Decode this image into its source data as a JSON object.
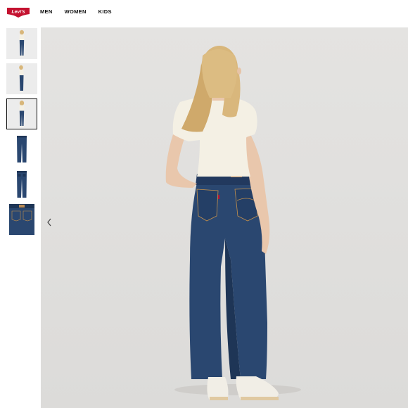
{
  "brand": {
    "logo_text": "Levi's",
    "color": "#c41230"
  },
  "nav": {
    "items": [
      "MEN",
      "WOMEN",
      "KIDS"
    ]
  },
  "gallery": {
    "thumbnails": [
      {
        "view": "front",
        "selected": false
      },
      {
        "view": "side",
        "selected": false
      },
      {
        "view": "back",
        "selected": true
      },
      {
        "view": "product-front",
        "selected": false
      },
      {
        "view": "product-back",
        "selected": false
      },
      {
        "view": "detail-waistband",
        "selected": false
      }
    ],
    "prev_icon": "chevron-left-icon"
  },
  "colors": {
    "denim": "#2a4770",
    "denim_dark": "#1e3556",
    "top": "#f4f0e4",
    "hair": "#d8b67a",
    "background": "#e2e1df"
  }
}
